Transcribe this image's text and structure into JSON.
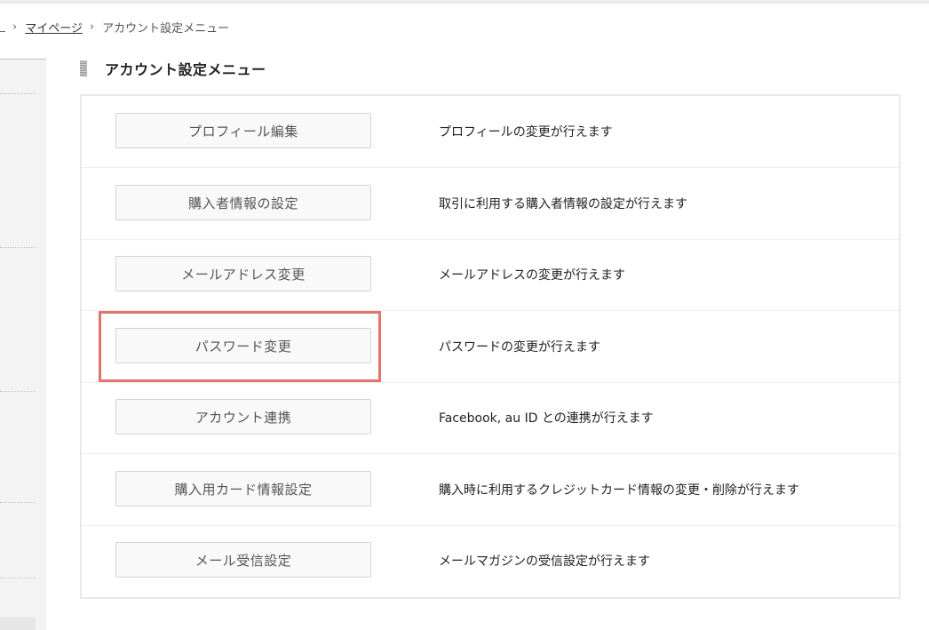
{
  "breadcrumb": {
    "items": [
      {
        "label": "マイページ",
        "link": true
      },
      {
        "label": "アカウント設定メニュー",
        "link": false
      }
    ]
  },
  "page": {
    "title": "アカウント設定メニュー"
  },
  "menu": {
    "items": [
      {
        "button": "プロフィール編集",
        "description": "プロフィールの変更が行えます"
      },
      {
        "button": "購入者情報の設定",
        "description": "取引に利用する購入者情報の設定が行えます"
      },
      {
        "button": "メールアドレス変更",
        "description": "メールアドレスの変更が行えます"
      },
      {
        "button": "パスワード変更",
        "description": "パスワードの変更が行えます"
      },
      {
        "button": "アカウント連携",
        "description": "Facebook, au ID との連携が行えます"
      },
      {
        "button": "購入用カード情報設定",
        "description": "購入時に利用するクレジットカード情報の変更・削除が行えます"
      },
      {
        "button": "メール受信設定",
        "description": "メールマガジンの受信設定が行えます"
      }
    ]
  },
  "colors": {
    "highlight": "#e2746a",
    "border": "#e9e9e9",
    "button_bg": "#f9f9f9"
  }
}
